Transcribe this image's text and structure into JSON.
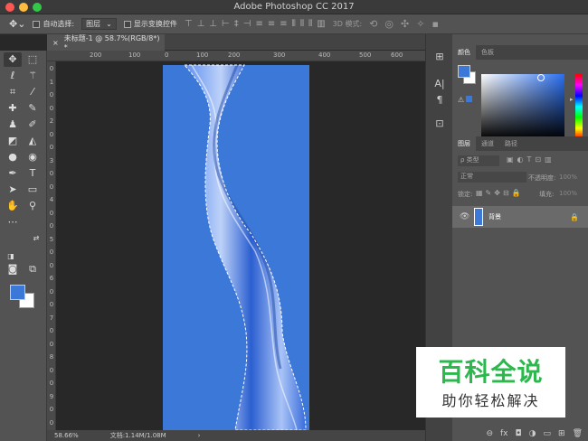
{
  "app": {
    "title": "Adobe Photoshop CC 2017"
  },
  "options": {
    "auto_select": "自动选择:",
    "layer_select": "图层",
    "show_transform": "显示变换控件",
    "mode3d": "3D 模式:"
  },
  "document": {
    "tab_title": "未标题-1 @ 58.7%(RGB/8*) *"
  },
  "ruler": {
    "top_ticks": [
      "200",
      "100",
      "0",
      "100",
      "200",
      "300",
      "400",
      "500",
      "600"
    ],
    "left_ticks": [
      "0",
      "1",
      "0",
      "0",
      "2",
      "0",
      "0",
      "3",
      "0",
      "0",
      "4",
      "0",
      "0",
      "5",
      "0",
      "0",
      "6",
      "0",
      "0",
      "7",
      "0",
      "0",
      "8",
      "0",
      "0",
      "9",
      "0",
      "0"
    ]
  },
  "status": {
    "zoom": "58.66%",
    "doc_info": "文档:1.14M/1.08M",
    "arrow": "›"
  },
  "panels": {
    "color_tabs": [
      "颜色",
      "色板"
    ],
    "layers_tabs": [
      "图层",
      "通道",
      "路径"
    ],
    "kind_label": "ρ 类型",
    "blend_mode": "正常",
    "opacity_label": "不透明度:",
    "opacity_value": "100%",
    "lock_label": "锁定:",
    "fill_label": "填充:",
    "fill_value": "100%",
    "layer_name": "背景"
  },
  "colors": {
    "foreground": "#3c78d8",
    "background": "#ffffff",
    "accent_green": "#2db84d"
  },
  "watermark": {
    "title": "百科全说",
    "subtitle": "助你轻松解决"
  }
}
